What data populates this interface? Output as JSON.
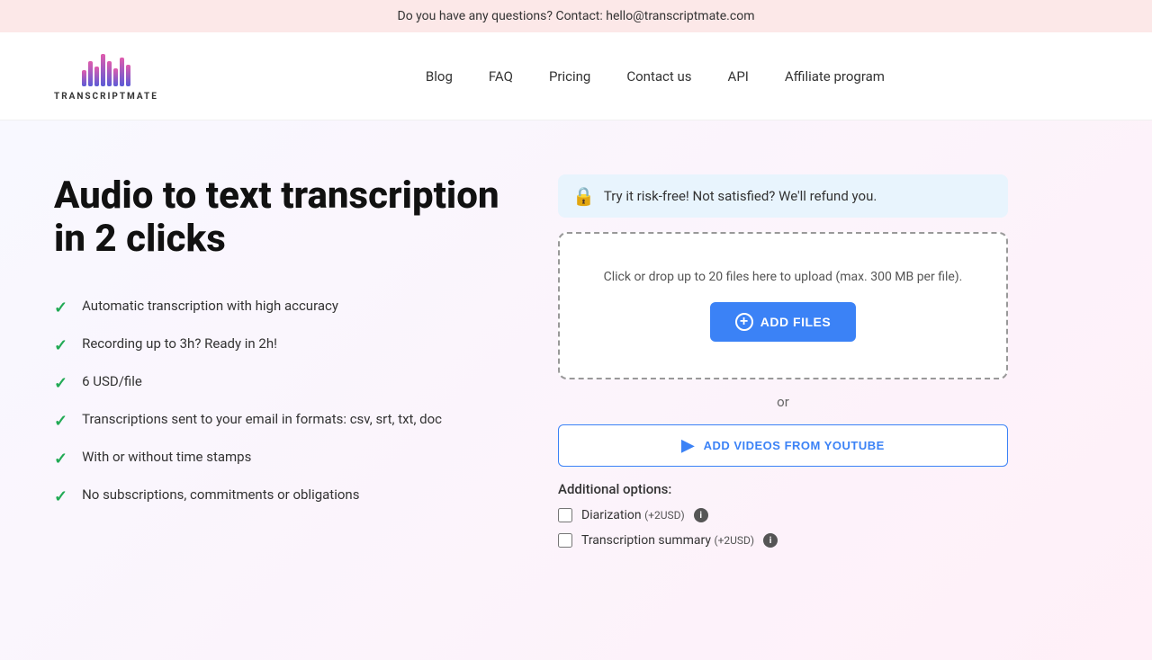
{
  "banner": {
    "text": "Do you have any questions? Contact: hello@transcriptmate.com"
  },
  "logo": {
    "name": "TRANSCRIPTMATE"
  },
  "nav": {
    "items": [
      {
        "id": "blog",
        "label": "Blog"
      },
      {
        "id": "faq",
        "label": "FAQ"
      },
      {
        "id": "pricing",
        "label": "Pricing"
      },
      {
        "id": "contact",
        "label": "Contact us"
      },
      {
        "id": "api",
        "label": "API"
      },
      {
        "id": "affiliate",
        "label": "Affiliate program"
      }
    ]
  },
  "hero": {
    "title": "Audio to text transcription in 2 clicks",
    "features": [
      {
        "text": "Automatic transcription with high accuracy"
      },
      {
        "text": "Recording up to 3h? Ready in 2h!"
      },
      {
        "text": "6 USD/file"
      },
      {
        "text": "Transcriptions sent to your email in formats: csv, srt, txt, doc"
      },
      {
        "text": "With or without time stamps"
      },
      {
        "text": "No subscriptions, commitments or obligations"
      }
    ]
  },
  "upload": {
    "risk_free_text": "Try it risk-free! Not satisfied? We'll refund you.",
    "upload_hint": "Click or drop up to 20 files here to upload (max. 300 MB per file).",
    "add_files_label": "ADD FILES",
    "or_label": "or",
    "youtube_label": "ADD VIDEOS FROM YOUTUBE",
    "additional_options_label": "Additional options:",
    "options": [
      {
        "id": "diarization",
        "label": "Diarization",
        "price": "(+2USD)"
      },
      {
        "id": "summary",
        "label": "Transcription summary",
        "price": "(+2USD)"
      }
    ]
  }
}
